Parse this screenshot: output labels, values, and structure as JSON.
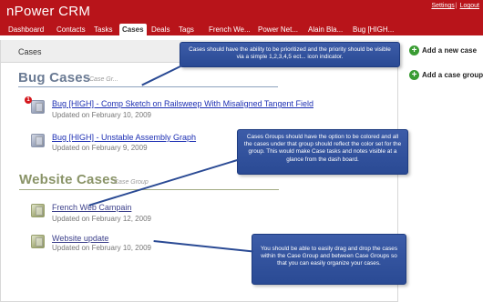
{
  "app": {
    "title": "nPower CRM",
    "links": [
      "Settings",
      "Logout"
    ]
  },
  "nav": {
    "tabs": [
      "Dashboard",
      "Contacts",
      "Tasks",
      "Cases",
      "Deals",
      "Tags",
      "French We...",
      "Power Net...",
      "Alain Bla...",
      "Bug [HIGH..."
    ],
    "active": "Cases"
  },
  "panel": {
    "title": "Cases"
  },
  "groups": [
    {
      "name": "Bug Cases",
      "subtitle": "Case Gr...",
      "color": "#6b7b94",
      "items": [
        {
          "title": "Bug [HIGH] - Comp Sketch on Railsweep With Misaligned Tangent Field",
          "date": "Updated on February 10, 2009",
          "priority": "1"
        },
        {
          "title": "Bug [HIGH] - Unstable Assembly Graph",
          "date": "Updated on February 9, 2009"
        }
      ]
    },
    {
      "name": "Website Cases",
      "subtitle": "Case Group",
      "color": "#8a9468",
      "items": [
        {
          "title": "French Web Campain",
          "date": "Updated on February 12, 2009"
        },
        {
          "title": "Website update",
          "date": "Updated on February 10, 2009"
        }
      ]
    }
  ],
  "sidebar": {
    "add_case": "Add a new case",
    "add_group": "Add a case group"
  },
  "callouts": [
    "Cases should have the ability to be prioritized and the priority should be visible via a simple 1,2,3,4,5 ect... icon indicator.",
    "Cases Groups should have the option to be colored and all the cases under that group should reflect the color set for the group. This would make Case tasks and notes visible at a glance from the dash board.",
    "You should be able to easily drag and drop the cases within the Case Group and between Case Groups so that you can easily organize your cases."
  ]
}
